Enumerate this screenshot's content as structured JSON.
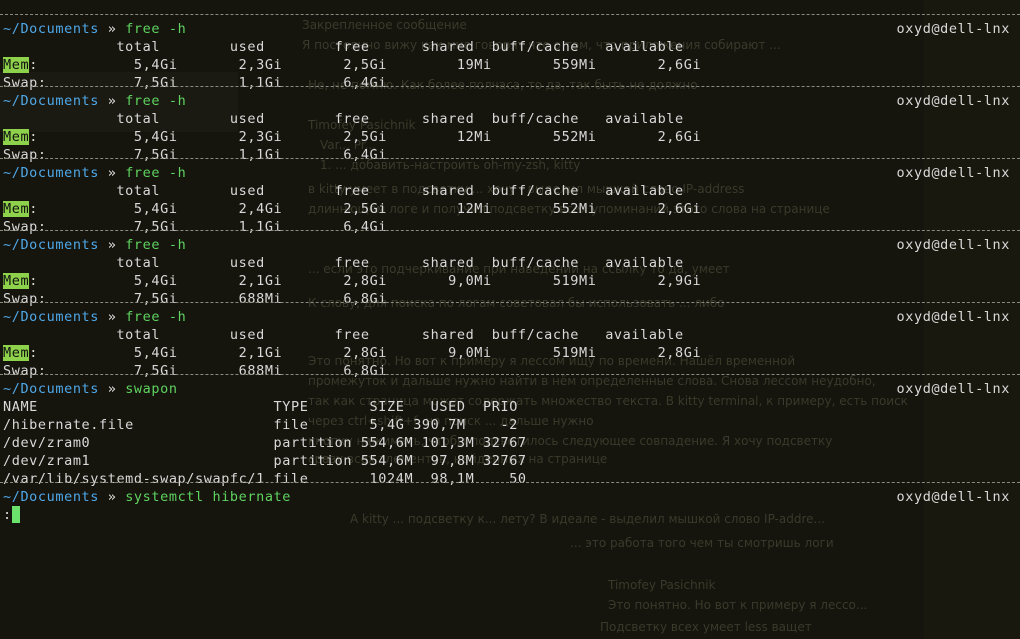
{
  "terminal": {
    "host": "oxyd@dell-lnx",
    "prompt_dir": "~/Documents",
    "prompt_arrow": "»",
    "blocks": [
      {
        "command": "free -h",
        "rows": [
          "             total        used        free      shared  buff/cache   available",
          "{Mem}:           5,4Gi       2,3Gi       2,5Gi        19Mi       559Mi       2,6Gi",
          "Swap:          7,5Gi       1,1Gi       6,4Gi"
        ]
      },
      {
        "command": "free -h",
        "rows": [
          "             total        used        free      shared  buff/cache   available",
          "{Mem}:           5,4Gi       2,3Gi       2,5Gi        12Mi       552Mi       2,6Gi",
          "Swap:          7,5Gi       1,1Gi       6,4Gi"
        ]
      },
      {
        "command": "free -h",
        "rows": [
          "             total        used        free      shared  buff/cache   available",
          "{Mem}:           5,4Gi       2,4Gi       2,5Gi        12Mi       552Mi       2,6Gi",
          "Swap:          7,5Gi       1,1Gi       6,4Gi"
        ]
      },
      {
        "command": "free -h",
        "rows": [
          "             total        used        free      shared  buff/cache   available",
          "{Mem}:           5,4Gi       2,1Gi       2,8Gi       9,0Mi       519Mi       2,9Gi",
          "Swap:          7,5Gi       688Mi       6,8Gi"
        ]
      },
      {
        "command": "free -h",
        "rows": [
          "             total        used        free      shared  buff/cache   available",
          "{Mem}:           5,4Gi       2,1Gi       2,8Gi       9,0Mi       519Mi       2,8Gi",
          "Swap:          7,5Gi       688Mi       6,8Gi"
        ]
      },
      {
        "command": "swapon",
        "rows": [
          "NAME                           TYPE       SIZE   USED  PRIO",
          "/hibernate.file                file       5,4G 390,7M    -2",
          "/dev/zram0                     partition 554,6M 101,3M 32767",
          "/dev/zram1                     partition 554,6M  97,8M 32767",
          "/var/lib/systemd-swap/swapfc/1 file       1024M  98,1M    50"
        ]
      },
      {
        "command": "systemctl hibernate",
        "rows": [
          ":"
        ]
      }
    ]
  },
  "background": {
    "chat_lines": [
      "Закрепленное сообщение",
      "Я постоянно вижу как мне говорят что о том, что приложения собирают ...",
      "Не, не помню. Как более полчаса, то да, так быть не должно",
      "Timofey Pasichnik",
      "Var... Pr...",
      "1. ... добавить-настроить oh-my-zsh, kitty",
      "в kitty умеет в подсветку ... хочу - выделил мышкой слово IP-address",
      "длиннющем логе и получил подсветку всех упоминаний этого слова на странице",
      "... если это подчеркивание при наведении на ссылку то да, умеет",
      "К слову, для поиска по логам советовал бы использовать ... либо",
      "Это понятно. Но вот к примеру я лессом ищу по времени. Нашёл временной",
      "промежуток и дальше нужно найти в нём определенные слова. Снова лессом неудобно,",
      "так как страница может содержать множество текста. В kitty terminal, к примеру, есть поиск",
      "через ctrl+shift+f, но поиск ... дальше нужно",
      "кнопку нажимать, чтобы подсветилось следующее совпадение. Я хочу подсветку",
      "сразу всех элементов, найденных на странице",
      "A kitty ... подсветку к... лету? В идеале - выделил мышкой слово IP-addre...",
      "... это работа того чем ты смотришь логи",
      "Timofey Pasichnik",
      "Это понятно. Но вот к примеру я лессо...",
      "Подсветку всех умеет less ващет"
    ]
  }
}
